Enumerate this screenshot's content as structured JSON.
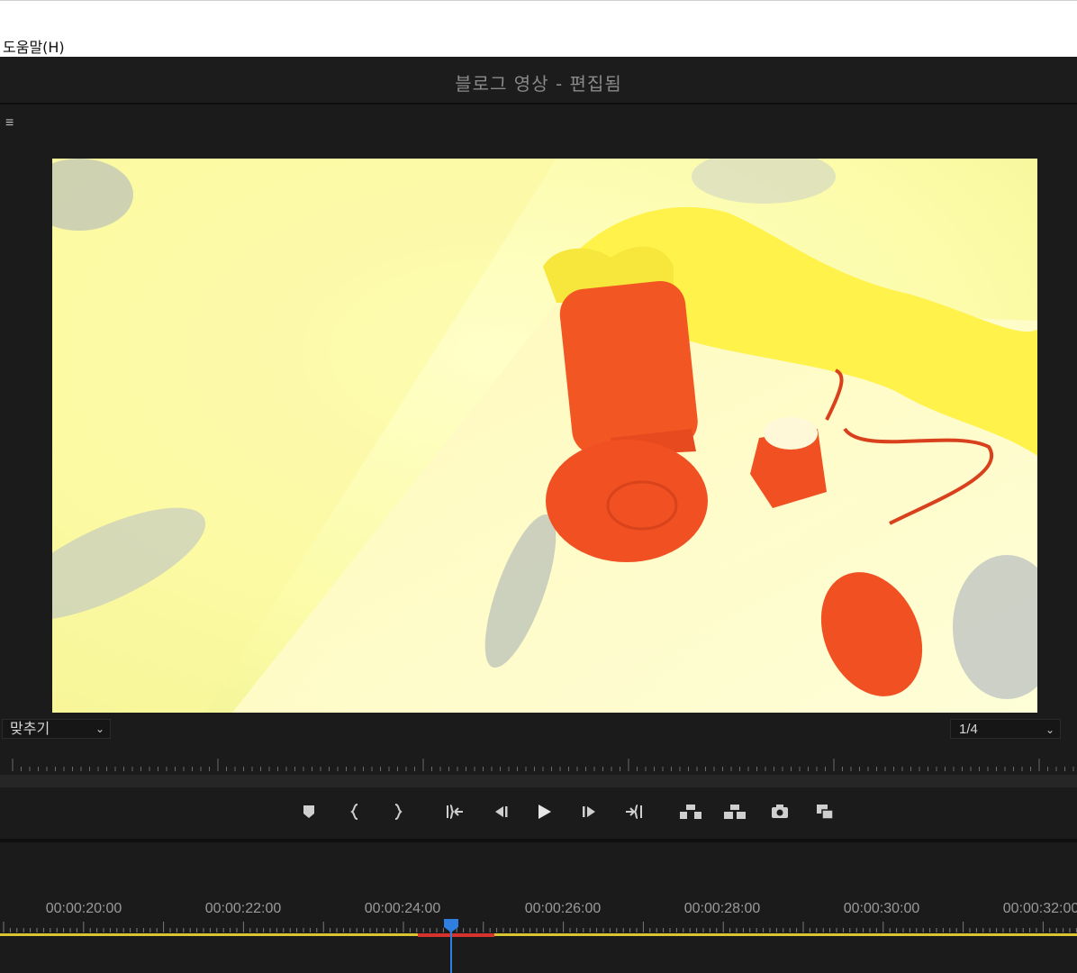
{
  "menu": {
    "help": "도움말(H)"
  },
  "program_monitor": {
    "title": "블로그 영상 - 편집됨",
    "panel_menu_icon": "hamburger-icon",
    "fit_label": "맞추기",
    "resolution_label": "1/4"
  },
  "transport": {
    "buttons": [
      "add-marker-icon",
      "mark-in-icon",
      "mark-out-icon",
      "go-to-in-icon",
      "step-back-icon",
      "play-icon",
      "step-forward-icon",
      "go-to-out-icon",
      "lift-icon",
      "extract-icon",
      "export-frame-icon",
      "comparison-view-icon"
    ]
  },
  "timeline": {
    "timecodes": [
      "00:00:20:00",
      "00:00:22:00",
      "00:00:24:00",
      "00:00:26:00",
      "00:00:28:00",
      "00:00:30:00",
      "00:00:32:00"
    ]
  },
  "colors": {
    "accent_blue": "#2e7fe0",
    "work_area": "#d7c631",
    "in_out": "#d6332e"
  }
}
